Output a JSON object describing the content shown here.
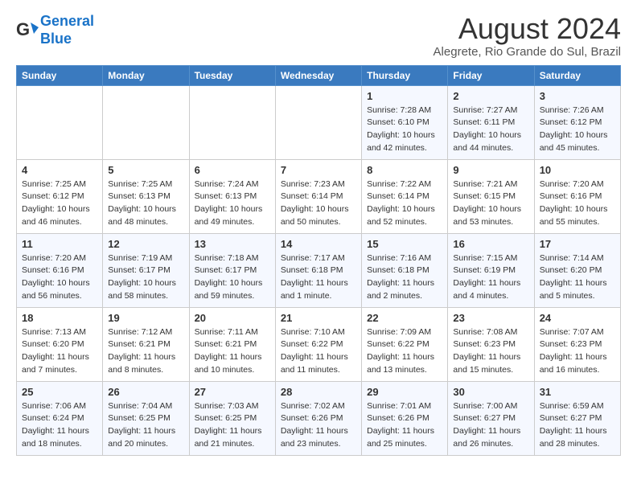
{
  "logo": {
    "line1": "General",
    "line2": "Blue"
  },
  "title": "August 2024",
  "subtitle": "Alegrete, Rio Grande do Sul, Brazil",
  "weekdays": [
    "Sunday",
    "Monday",
    "Tuesday",
    "Wednesday",
    "Thursday",
    "Friday",
    "Saturday"
  ],
  "weeks": [
    [
      {
        "day": "",
        "info": ""
      },
      {
        "day": "",
        "info": ""
      },
      {
        "day": "",
        "info": ""
      },
      {
        "day": "",
        "info": ""
      },
      {
        "day": "1",
        "info": "Sunrise: 7:28 AM\nSunset: 6:10 PM\nDaylight: 10 hours\nand 42 minutes."
      },
      {
        "day": "2",
        "info": "Sunrise: 7:27 AM\nSunset: 6:11 PM\nDaylight: 10 hours\nand 44 minutes."
      },
      {
        "day": "3",
        "info": "Sunrise: 7:26 AM\nSunset: 6:12 PM\nDaylight: 10 hours\nand 45 minutes."
      }
    ],
    [
      {
        "day": "4",
        "info": "Sunrise: 7:25 AM\nSunset: 6:12 PM\nDaylight: 10 hours\nand 46 minutes."
      },
      {
        "day": "5",
        "info": "Sunrise: 7:25 AM\nSunset: 6:13 PM\nDaylight: 10 hours\nand 48 minutes."
      },
      {
        "day": "6",
        "info": "Sunrise: 7:24 AM\nSunset: 6:13 PM\nDaylight: 10 hours\nand 49 minutes."
      },
      {
        "day": "7",
        "info": "Sunrise: 7:23 AM\nSunset: 6:14 PM\nDaylight: 10 hours\nand 50 minutes."
      },
      {
        "day": "8",
        "info": "Sunrise: 7:22 AM\nSunset: 6:14 PM\nDaylight: 10 hours\nand 52 minutes."
      },
      {
        "day": "9",
        "info": "Sunrise: 7:21 AM\nSunset: 6:15 PM\nDaylight: 10 hours\nand 53 minutes."
      },
      {
        "day": "10",
        "info": "Sunrise: 7:20 AM\nSunset: 6:16 PM\nDaylight: 10 hours\nand 55 minutes."
      }
    ],
    [
      {
        "day": "11",
        "info": "Sunrise: 7:20 AM\nSunset: 6:16 PM\nDaylight: 10 hours\nand 56 minutes."
      },
      {
        "day": "12",
        "info": "Sunrise: 7:19 AM\nSunset: 6:17 PM\nDaylight: 10 hours\nand 58 minutes."
      },
      {
        "day": "13",
        "info": "Sunrise: 7:18 AM\nSunset: 6:17 PM\nDaylight: 10 hours\nand 59 minutes."
      },
      {
        "day": "14",
        "info": "Sunrise: 7:17 AM\nSunset: 6:18 PM\nDaylight: 11 hours\nand 1 minute."
      },
      {
        "day": "15",
        "info": "Sunrise: 7:16 AM\nSunset: 6:18 PM\nDaylight: 11 hours\nand 2 minutes."
      },
      {
        "day": "16",
        "info": "Sunrise: 7:15 AM\nSunset: 6:19 PM\nDaylight: 11 hours\nand 4 minutes."
      },
      {
        "day": "17",
        "info": "Sunrise: 7:14 AM\nSunset: 6:20 PM\nDaylight: 11 hours\nand 5 minutes."
      }
    ],
    [
      {
        "day": "18",
        "info": "Sunrise: 7:13 AM\nSunset: 6:20 PM\nDaylight: 11 hours\nand 7 minutes."
      },
      {
        "day": "19",
        "info": "Sunrise: 7:12 AM\nSunset: 6:21 PM\nDaylight: 11 hours\nand 8 minutes."
      },
      {
        "day": "20",
        "info": "Sunrise: 7:11 AM\nSunset: 6:21 PM\nDaylight: 11 hours\nand 10 minutes."
      },
      {
        "day": "21",
        "info": "Sunrise: 7:10 AM\nSunset: 6:22 PM\nDaylight: 11 hours\nand 11 minutes."
      },
      {
        "day": "22",
        "info": "Sunrise: 7:09 AM\nSunset: 6:22 PM\nDaylight: 11 hours\nand 13 minutes."
      },
      {
        "day": "23",
        "info": "Sunrise: 7:08 AM\nSunset: 6:23 PM\nDaylight: 11 hours\nand 15 minutes."
      },
      {
        "day": "24",
        "info": "Sunrise: 7:07 AM\nSunset: 6:23 PM\nDaylight: 11 hours\nand 16 minutes."
      }
    ],
    [
      {
        "day": "25",
        "info": "Sunrise: 7:06 AM\nSunset: 6:24 PM\nDaylight: 11 hours\nand 18 minutes."
      },
      {
        "day": "26",
        "info": "Sunrise: 7:04 AM\nSunset: 6:25 PM\nDaylight: 11 hours\nand 20 minutes."
      },
      {
        "day": "27",
        "info": "Sunrise: 7:03 AM\nSunset: 6:25 PM\nDaylight: 11 hours\nand 21 minutes."
      },
      {
        "day": "28",
        "info": "Sunrise: 7:02 AM\nSunset: 6:26 PM\nDaylight: 11 hours\nand 23 minutes."
      },
      {
        "day": "29",
        "info": "Sunrise: 7:01 AM\nSunset: 6:26 PM\nDaylight: 11 hours\nand 25 minutes."
      },
      {
        "day": "30",
        "info": "Sunrise: 7:00 AM\nSunset: 6:27 PM\nDaylight: 11 hours\nand 26 minutes."
      },
      {
        "day": "31",
        "info": "Sunrise: 6:59 AM\nSunset: 6:27 PM\nDaylight: 11 hours\nand 28 minutes."
      }
    ]
  ]
}
